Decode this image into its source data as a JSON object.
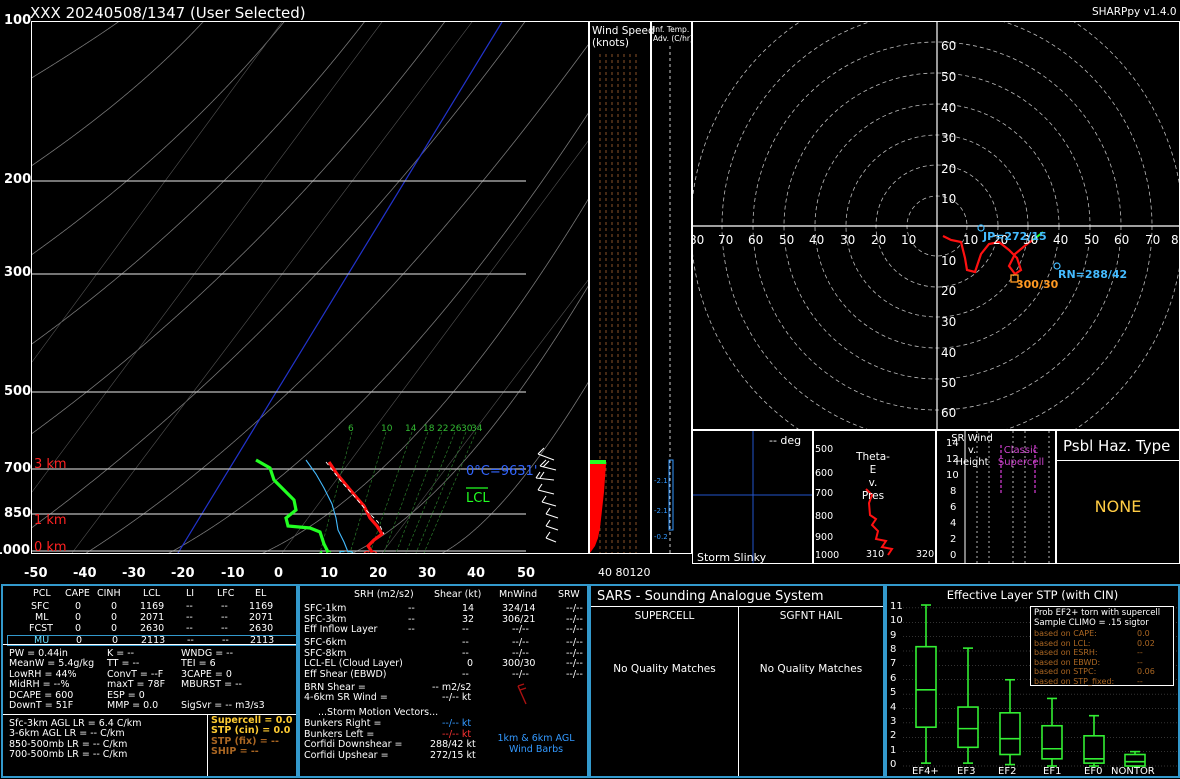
{
  "header": {
    "title": "XXX  20240508/1347  (User Selected)",
    "app": "SHARPpy v1.4.0"
  },
  "skewt": {
    "pressure_ticks": [
      "100",
      "200",
      "300",
      "500",
      "700",
      "850",
      "1000"
    ],
    "temp_ticks": [
      "-50",
      "-40",
      "-30",
      "-20",
      "-10",
      "0",
      "10",
      "20",
      "30",
      "40",
      "50"
    ],
    "height_labels": [
      "3 km",
      "1 km",
      "0 km"
    ],
    "freezing_label": "0°C=9631'",
    "lcl_label": "LCL",
    "mixing_ratio_labels": [
      "6",
      "10",
      "14",
      "18",
      "22",
      "26",
      "30",
      "34"
    ],
    "sfc_readouts": {
      "td": "46",
      "wb": "53",
      "t": "62"
    },
    "colors": {
      "temp": "#ff0000",
      "dewpoint": "#00ff00",
      "wetbulb": "#00ffff",
      "isobar": "#bbbbbb",
      "dry_adiabat": "#aaaaaa",
      "isotherm_zero": "#3344dd"
    }
  },
  "wind_speed": {
    "title": "Wind Speed\n(knots)",
    "title_l1": "Wind Speed",
    "title_l2": "(knots)",
    "ticks": [
      "40",
      "80",
      "120"
    ]
  },
  "inferred_temp": {
    "title_l1": "Inf. Temp.",
    "title_l2": "Adv. (C/hr)",
    "values": [
      "-2.1",
      "-2.1",
      "-0.2"
    ]
  },
  "hodograph": {
    "y_ticks_upper": [
      "60",
      "50",
      "40",
      "30",
      "20",
      "10"
    ],
    "x_ticks": [
      "80",
      "70",
      "60",
      "50",
      "40",
      "30",
      "20",
      "10",
      "10",
      "20",
      "30",
      "40",
      "50",
      "60",
      "70",
      "80"
    ],
    "y_ticks_lower": [
      "10",
      "20",
      "30",
      "40",
      "50",
      "60"
    ],
    "storm_labels": {
      "left_mover": "JP=272/15",
      "right_mover": "RN=288/42",
      "mean": "300/30"
    }
  },
  "storm_slinky": {
    "deg_label": "-- deg",
    "title": "Storm Slinky"
  },
  "theta_e": {
    "title_l1": "Theta-E",
    "title_l2": "v.",
    "title_l3": "Pres",
    "p_ticks": [
      "500",
      "600",
      "700",
      "800",
      "900",
      "1000"
    ],
    "x_ticks": [
      "310",
      "320"
    ]
  },
  "sr_wind": {
    "title_l1": "SR Wind",
    "title_l2": "v.",
    "title_l3": "Height",
    "classic_l1": "Classic",
    "classic_l2": "Supercell",
    "h_ticks": [
      "14",
      "12",
      "10",
      "8",
      "6",
      "4",
      "2",
      "0"
    ]
  },
  "haz_type": {
    "title": "Psbl Haz. Type",
    "value": "NONE",
    "value_color": "#ffcc44"
  },
  "parcels": {
    "headers": [
      "PCL",
      "CAPE",
      "CINH",
      "LCL",
      "LI",
      "LFC",
      "EL"
    ],
    "rows": [
      [
        "SFC",
        "0",
        "0",
        "1169",
        "--",
        "--",
        "1169"
      ],
      [
        "ML",
        "0",
        "0",
        "2071",
        "--",
        "--",
        "2071"
      ],
      [
        "FCST",
        "0",
        "0",
        "2630",
        "--",
        "--",
        "2630"
      ],
      [
        "MU",
        "0",
        "0",
        "2113",
        "--",
        "--",
        "2113"
      ]
    ],
    "indices_col1": [
      "PW = 0.44in",
      "MeanW = 5.4g/kg",
      "LowRH = 44%",
      "MidRH = --%",
      "DCAPE = 600",
      "DownT = 51F"
    ],
    "indices_col2": [
      "K = --",
      "TT = --",
      "ConvT = --F",
      "maxT = 78F",
      "ESP = 0",
      "MMP = 0.0"
    ],
    "indices_col3": [
      "WNDG = --",
      "TEI = 6",
      "3CAPE = 0",
      "MBURST = --",
      "",
      "SigSvr = -- m3/s3"
    ],
    "lapse_rates": [
      "Sfc-3km AGL LR = 6.4 C/km",
      "3-6km AGL LR = -- C/km",
      "850-500mb LR = -- C/km",
      "700-500mb LR = -- C/km"
    ],
    "composites": [
      {
        "label": "Supercell = 0.0",
        "color": "#ffcc33"
      },
      {
        "label": "STP (cin) = 0.0",
        "color": "#ffcc33"
      },
      {
        "label": "STP (fix) = --",
        "color": "#aa6622"
      },
      {
        "label": "SHIP = --",
        "color": "#aa6622"
      }
    ]
  },
  "kinematics": {
    "headers": [
      "SRH (m2/s2)",
      "Shear (kt)",
      "MnWind",
      "SRW"
    ],
    "rows1": [
      [
        "SFC-1km",
        "--",
        "14",
        "324/14",
        "--/--"
      ],
      [
        "SFC-3km",
        "--",
        "32",
        "306/21",
        "--/--"
      ],
      [
        "Eff Inflow Layer",
        "--",
        "--",
        "--/--",
        "--/--"
      ]
    ],
    "rows2": [
      [
        "SFC-6km",
        "",
        "--",
        "--/--",
        "--/--"
      ],
      [
        "SFC-8km",
        "",
        "--",
        "--/--",
        "--/--"
      ],
      [
        "LCL-EL (Cloud Layer)",
        "",
        "0",
        "300/30",
        "--/--"
      ],
      [
        "Eff Shear (EBWD)",
        "",
        "--",
        "--/--",
        "--/--"
      ]
    ],
    "brn_shear_label": "BRN Shear =",
    "brn_shear_value": "-- m2/s2",
    "sr_wind_label": "4-6km SR Wind =",
    "sr_wind_value": "--/-- kt",
    "storm_title": "...Storm Motion Vectors...",
    "motions": [
      {
        "label": "Bunkers Right =",
        "value": "--/-- kt",
        "color": "#3399ff"
      },
      {
        "label": "Bunkers Left =",
        "value": "--/-- kt",
        "color": "#ff3333"
      },
      {
        "label": "Corfidi Downshear =",
        "value": "288/42 kt",
        "color": "#ffffff"
      },
      {
        "label": "Corfidi Upshear =",
        "value": "272/15 kt",
        "color": "#ffffff"
      }
    ],
    "barbs_l1": "1km & 6km AGL",
    "barbs_l2": "Wind Barbs"
  },
  "sars": {
    "title": "SARS - Sounding Analogue System",
    "supercell_title": "SUPERCELL",
    "hail_title": "SGFNT HAIL",
    "supercell_msg": "No Quality Matches",
    "hail_msg": "No Quality Matches"
  },
  "stp": {
    "title": "Effective Layer STP (with CIN)",
    "y_ticks": [
      "11",
      "10",
      "9",
      "8",
      "7",
      "6",
      "5",
      "4",
      "3",
      "2",
      "1",
      "0"
    ],
    "categories": [
      "EF4+",
      "EF3",
      "EF2",
      "EF1",
      "EF0",
      "NONTOR"
    ],
    "legend_title_l1": "Prob EF2+ torn with supercell",
    "legend_title_l2": "Sample CLIMO = .15 sigtor",
    "legend_rows": [
      {
        "label": "based on CAPE:",
        "value": "0.0"
      },
      {
        "label": "based on LCL:",
        "value": "0.02"
      },
      {
        "label": "based on ESRH:",
        "value": "--"
      },
      {
        "label": "based on EBWD:",
        "value": "--"
      },
      {
        "label": "based on STPC:",
        "value": "0.06"
      },
      {
        "label": "based on STP_fixed:",
        "value": "--"
      }
    ],
    "box_stats": [
      {
        "min": 0.2,
        "q1": 2.7,
        "median": 5.3,
        "q3": 8.3,
        "max": 11.2
      },
      {
        "min": 0.2,
        "q1": 1.3,
        "median": 2.6,
        "q3": 4.1,
        "max": 8.2
      },
      {
        "min": 0.1,
        "q1": 0.8,
        "median": 1.9,
        "q3": 3.7,
        "max": 6.0
      },
      {
        "min": 0.0,
        "q1": 0.5,
        "median": 1.2,
        "q3": 2.8,
        "max": 4.7
      },
      {
        "min": 0.0,
        "q1": 0.2,
        "median": 0.5,
        "q3": 2.1,
        "max": 3.5
      },
      {
        "min": 0.0,
        "q1": 0.0,
        "median": 0.3,
        "q3": 0.8,
        "max": 1.0
      }
    ]
  }
}
